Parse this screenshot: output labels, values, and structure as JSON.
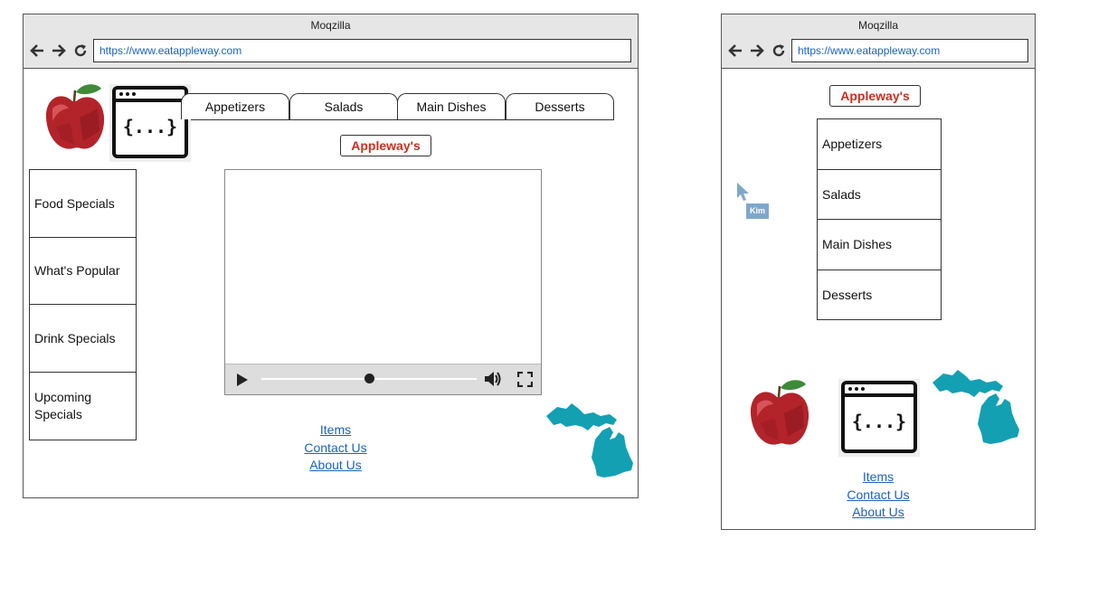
{
  "desktop": {
    "window_title": "Moqzilla",
    "url": "https://www.eatappleway.com",
    "tabs": [
      "Appetizers",
      "Salads",
      "Main Dishes",
      "Desserts"
    ],
    "brand": "Appleway's",
    "sidebar": [
      "Food Specials",
      "What's Popular",
      "Drink Specials",
      "Upcoming Specials"
    ],
    "video": {
      "progress": 0.5
    },
    "footer_links": [
      "Items",
      "Contact Us",
      "About Us"
    ]
  },
  "mobile": {
    "window_title": "Moqzilla",
    "url": "https://www.eatappleway.com",
    "brand": "Appleway's",
    "menu": [
      "Appetizers",
      "Salads",
      "Main Dishes",
      "Desserts"
    ],
    "footer_links": [
      "Items",
      "Contact Us",
      "About Us"
    ]
  },
  "cursor": {
    "user": "Kim"
  },
  "icons": [
    "apple-image",
    "code-window-icon",
    "michigan-map-image"
  ],
  "colors": {
    "brand": "#c8301c",
    "link": "#1a62c5",
    "michigan": "#13a0b3",
    "chrome": "#e6e6e6"
  }
}
